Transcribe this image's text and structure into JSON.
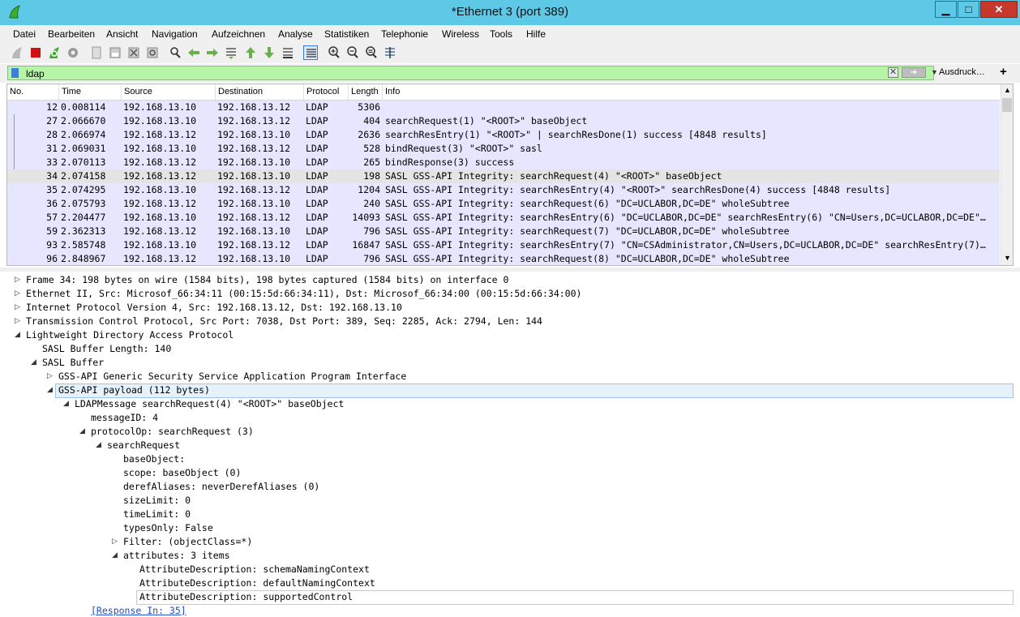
{
  "window": {
    "title": "*Ethernet 3 (port 389)",
    "controls": {
      "minimize": "▁",
      "maximize": "□",
      "close": "✕"
    }
  },
  "menu": [
    "Datei",
    "Bearbeiten",
    "Ansicht",
    "Navigation",
    "Aufzeichnen",
    "Analyse",
    "Statistiken",
    "Telephonie",
    "Wireless",
    "Tools",
    "Hilfe"
  ],
  "toolbar_icons": [
    "shark-fin-start-icon",
    "stop-square-icon",
    "restart-capture-icon",
    "capture-options-gear-icon",
    "open-file-icon",
    "save-file-icon",
    "close-file-icon",
    "reload-file-icon",
    "find-packet-icon",
    "go-back-icon",
    "go-forward-icon",
    "go-to-packet-icon",
    "go-first-icon",
    "go-last-icon",
    "autoscroll-icon",
    "colorize-list-icon",
    "zoom-in-icon",
    "zoom-out-icon",
    "zoom-normal-icon",
    "resize-columns-icon"
  ],
  "filter": {
    "value": "ldap",
    "expression_button": "Ausdruck…",
    "add_button": "+",
    "color": "#b6f5a8"
  },
  "packet_list": {
    "columns": [
      "No.",
      "Time",
      "Source",
      "Destination",
      "Protocol",
      "Length",
      "Info"
    ],
    "rows": [
      {
        "no": "12",
        "time": "0.008114",
        "src": "192.168.13.10",
        "dst": "192.168.13.12",
        "proto": "LDAP",
        "len": "5306",
        "info": "",
        "selected": false
      },
      {
        "no": "27",
        "time": "2.066670",
        "src": "192.168.13.10",
        "dst": "192.168.13.12",
        "proto": "LDAP",
        "len": "404",
        "info": "searchRequest(1) \"<ROOT>\" baseObject",
        "selected": false
      },
      {
        "no": "28",
        "time": "2.066974",
        "src": "192.168.13.12",
        "dst": "192.168.13.10",
        "proto": "LDAP",
        "len": "2636",
        "info": "searchResEntry(1) \"<ROOT>\"  | searchResDone(1) success  [4848 results]",
        "selected": false
      },
      {
        "no": "31",
        "time": "2.069031",
        "src": "192.168.13.10",
        "dst": "192.168.13.12",
        "proto": "LDAP",
        "len": "528",
        "info": "bindRequest(3) \"<ROOT>\" sasl",
        "selected": false
      },
      {
        "no": "33",
        "time": "2.070113",
        "src": "192.168.13.12",
        "dst": "192.168.13.10",
        "proto": "LDAP",
        "len": "265",
        "info": "bindResponse(3) success",
        "selected": false
      },
      {
        "no": "34",
        "time": "2.074158",
        "src": "192.168.13.12",
        "dst": "192.168.13.10",
        "proto": "LDAP",
        "len": "198",
        "info": "SASL GSS-API Integrity: searchRequest(4) \"<ROOT>\" baseObject",
        "selected": true
      },
      {
        "no": "35",
        "time": "2.074295",
        "src": "192.168.13.10",
        "dst": "192.168.13.12",
        "proto": "LDAP",
        "len": "1204",
        "info": "SASL GSS-API Integrity: searchResEntry(4) \"<ROOT>\" searchResDone(4) success  [4848 results]",
        "selected": false
      },
      {
        "no": "36",
        "time": "2.075793",
        "src": "192.168.13.12",
        "dst": "192.168.13.10",
        "proto": "LDAP",
        "len": "240",
        "info": "SASL GSS-API Integrity: searchRequest(6) \"DC=UCLABOR,DC=DE\" wholeSubtree",
        "selected": false
      },
      {
        "no": "57",
        "time": "2.204477",
        "src": "192.168.13.10",
        "dst": "192.168.13.12",
        "proto": "LDAP",
        "len": "14093",
        "info": "SASL GSS-API Integrity: searchResEntry(6) \"DC=UCLABOR,DC=DE\" searchResEntry(6) \"CN=Users,DC=UCLABOR,DC=DE\"…",
        "selected": false
      },
      {
        "no": "59",
        "time": "2.362313",
        "src": "192.168.13.12",
        "dst": "192.168.13.10",
        "proto": "LDAP",
        "len": "796",
        "info": "SASL GSS-API Integrity: searchRequest(7) \"DC=UCLABOR,DC=DE\" wholeSubtree",
        "selected": false
      },
      {
        "no": "93",
        "time": "2.585748",
        "src": "192.168.13.10",
        "dst": "192.168.13.12",
        "proto": "LDAP",
        "len": "16847",
        "info": "SASL GSS-API Integrity: searchResEntry(7) \"CN=CSAdministrator,CN=Users,DC=UCLABOR,DC=DE\" searchResEntry(7)…",
        "selected": false
      },
      {
        "no": "96",
        "time": "2.848967",
        "src": "192.168.13.12",
        "dst": "192.168.13.10",
        "proto": "LDAP",
        "len": "796",
        "info": "SASL GSS-API Integrity: searchRequest(8) \"DC=UCLABOR,DC=DE\" wholeSubtree",
        "selected": false
      }
    ],
    "row_color": "#e7e6ff",
    "selected_row_color": "#e4e4e4"
  },
  "details": [
    {
      "level": 0,
      "state": "collapsed",
      "text": "Frame 34: 198 bytes on wire (1584 bits), 198 bytes captured (1584 bits) on interface 0"
    },
    {
      "level": 0,
      "state": "collapsed",
      "text": "Ethernet II, Src: Microsof_66:34:11 (00:15:5d:66:34:11), Dst: Microsof_66:34:00 (00:15:5d:66:34:00)"
    },
    {
      "level": 0,
      "state": "collapsed",
      "text": "Internet Protocol Version 4, Src: 192.168.13.12, Dst: 192.168.13.10"
    },
    {
      "level": 0,
      "state": "collapsed",
      "text": "Transmission Control Protocol, Src Port: 7038, Dst Port: 389, Seq: 2285, Ack: 2794, Len: 144"
    },
    {
      "level": 0,
      "state": "expanded",
      "text": "Lightweight Directory Access Protocol"
    },
    {
      "level": 1,
      "state": "leaf",
      "text": "SASL Buffer Length: 140"
    },
    {
      "level": 1,
      "state": "expanded",
      "text": "SASL Buffer"
    },
    {
      "level": 2,
      "state": "collapsed",
      "text": "GSS-API Generic Security Service Application Program Interface"
    },
    {
      "level": 2,
      "state": "expanded",
      "text": "GSS-API payload (112 bytes)",
      "highlight": "primary"
    },
    {
      "level": 3,
      "state": "expanded",
      "text": "LDAPMessage searchRequest(4) \"<ROOT>\" baseObject"
    },
    {
      "level": 4,
      "state": "leaf",
      "text": "messageID: 4"
    },
    {
      "level": 4,
      "state": "expanded",
      "text": "protocolOp: searchRequest (3)"
    },
    {
      "level": 5,
      "state": "expanded",
      "text": "searchRequest"
    },
    {
      "level": 6,
      "state": "leaf",
      "text": "baseObject:"
    },
    {
      "level": 6,
      "state": "leaf",
      "text": "scope: baseObject (0)"
    },
    {
      "level": 6,
      "state": "leaf",
      "text": "derefAliases: neverDerefAliases (0)"
    },
    {
      "level": 6,
      "state": "leaf",
      "text": "sizeLimit: 0"
    },
    {
      "level": 6,
      "state": "leaf",
      "text": "timeLimit: 0"
    },
    {
      "level": 6,
      "state": "leaf",
      "text": "typesOnly: False"
    },
    {
      "level": 6,
      "state": "collapsed",
      "text": "Filter: (objectClass=*)"
    },
    {
      "level": 6,
      "state": "expanded",
      "text": "attributes: 3 items"
    },
    {
      "level": 7,
      "state": "leaf",
      "text": "AttributeDescription: schemaNamingContext"
    },
    {
      "level": 7,
      "state": "leaf",
      "text": "AttributeDescription: defaultNamingContext"
    },
    {
      "level": 7,
      "state": "leaf",
      "text": "AttributeDescription: supportedControl",
      "highlight": "secondary"
    },
    {
      "level": 4,
      "state": "leaf",
      "text": "[Response In: 35]",
      "link": true
    }
  ]
}
